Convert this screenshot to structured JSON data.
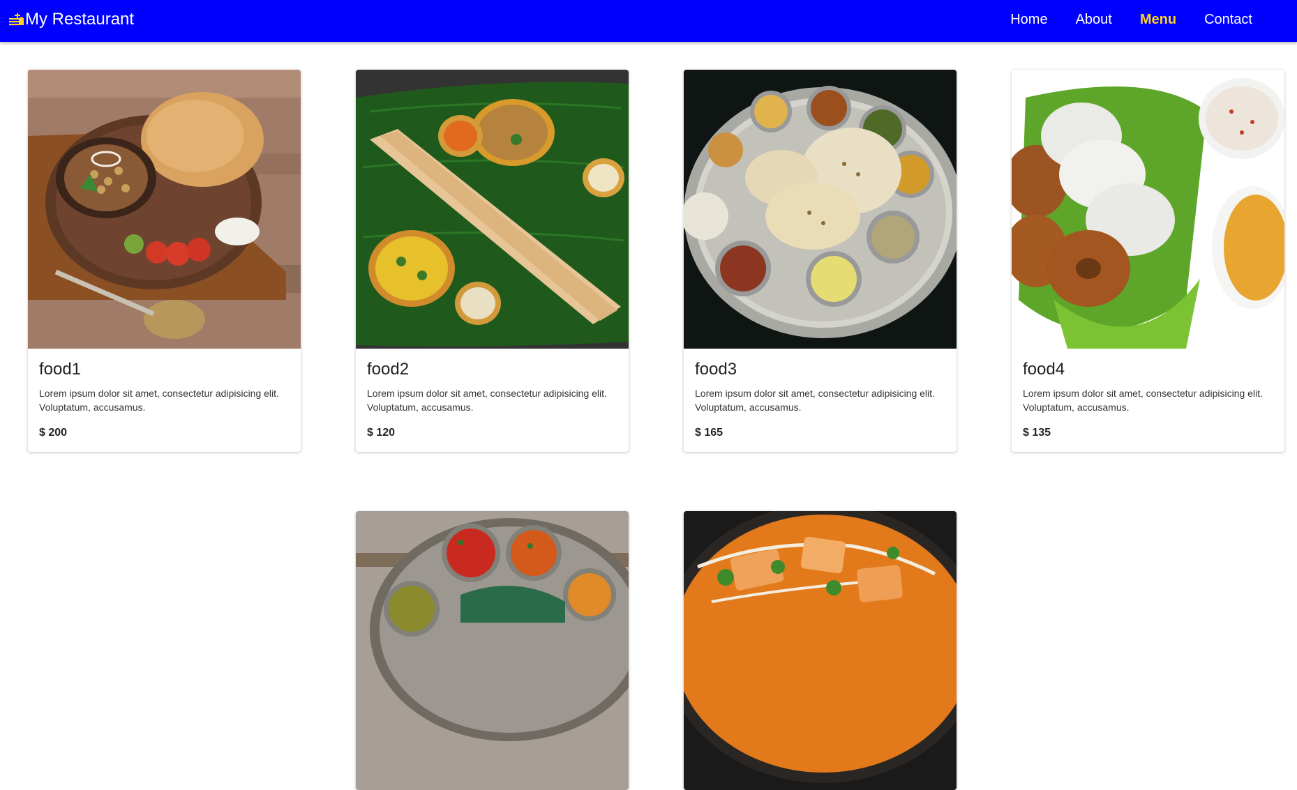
{
  "navbar": {
    "brand": "My Restaurant",
    "brand_icon": "burger-icon",
    "links": [
      {
        "label": "Home",
        "active": false
      },
      {
        "label": "About",
        "active": false
      },
      {
        "label": "Menu",
        "active": true
      },
      {
        "label": "Contact",
        "active": false
      }
    ],
    "colors": {
      "background": "#0000ff",
      "text": "#ffffff",
      "active": "#ffd21f"
    }
  },
  "menu": {
    "items": [
      {
        "name": "food1",
        "description": "Lorem ipsum dolor sit amet, consectetur adipisicing elit. Voluptatum, accusamus.",
        "price": "$ 200",
        "image": "chole-bhature-photo"
      },
      {
        "name": "food2",
        "description": "Lorem ipsum dolor sit amet, consectetur adipisicing elit. Voluptatum, accusamus.",
        "price": "$ 120",
        "image": "masala-dosa-photo"
      },
      {
        "name": "food3",
        "description": "Lorem ipsum dolor sit amet, consectetur adipisicing elit. Voluptatum, accusamus.",
        "price": "$ 165",
        "image": "thali-photo"
      },
      {
        "name": "food4",
        "description": "Lorem ipsum dolor sit amet, consectetur adipisicing elit. Voluptatum, accusamus.",
        "price": "$ 135",
        "image": "idli-vada-photo"
      },
      {
        "image": "south-indian-thali-photo"
      },
      {
        "image": "paneer-curry-photo"
      }
    ]
  }
}
